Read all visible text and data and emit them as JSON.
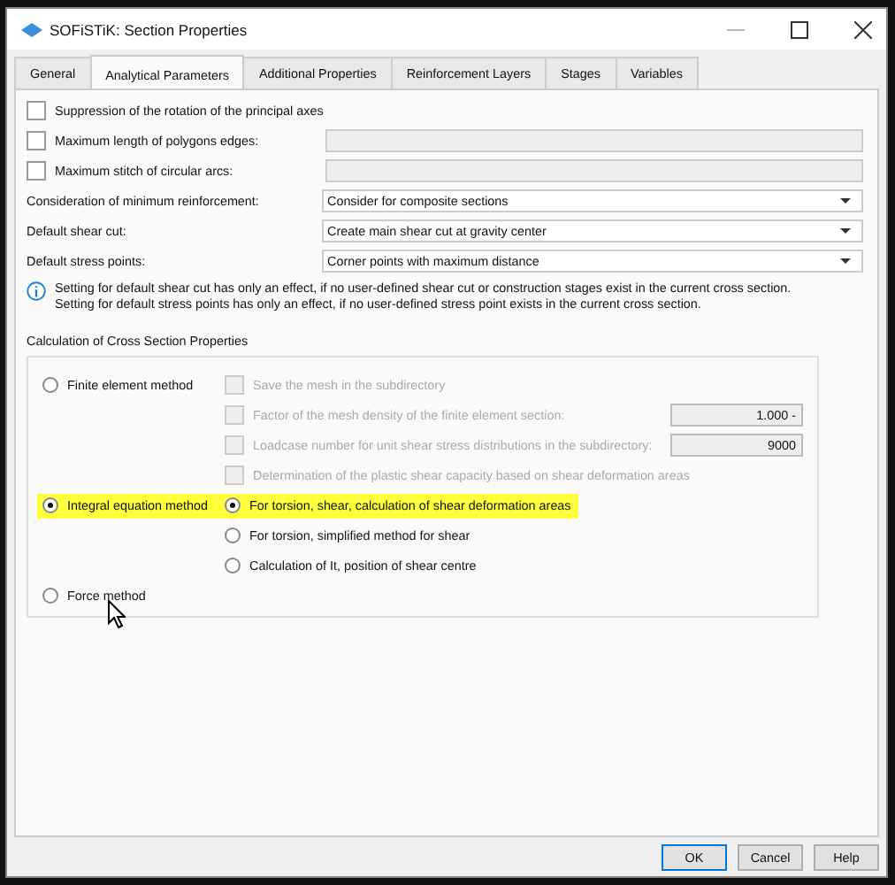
{
  "window": {
    "title": "SOFiSTiK: Section Properties"
  },
  "tabs": [
    {
      "label": "General",
      "selected": false
    },
    {
      "label": "Analytical Parameters",
      "selected": true
    },
    {
      "label": "Additional Properties",
      "selected": false
    },
    {
      "label": "Reinforcement Layers",
      "selected": false
    },
    {
      "label": "Stages",
      "selected": false
    },
    {
      "label": "Variables",
      "selected": false
    }
  ],
  "options": [
    {
      "kind": "checkbox",
      "label": "Suppression of the rotation of the principal axes",
      "checked": false
    },
    {
      "kind": "checkbox-field",
      "label": "Maximum length of polygons edges:",
      "checked": false,
      "disabled": true
    },
    {
      "kind": "checkbox-field",
      "label": "Maximum stitch of circular arcs:",
      "checked": false,
      "disabled": true
    }
  ],
  "dropdowns": [
    {
      "label": "Consideration of minimum reinforcement:",
      "value": "Consider for composite sections"
    },
    {
      "label": "Default shear cut:",
      "value": "Create main shear cut at gravity center"
    },
    {
      "label": "Default stress points:",
      "value": "Corner points with maximum distance"
    }
  ],
  "info": [
    "Setting for default shear cut has only an effect, if no user-defined shear cut or construction stages exist in the current cross section.",
    "Setting for default stress points has only an effect, if no user-defined stress point exists in the current cross section."
  ],
  "calculation": {
    "title": "Calculation of Cross Section Properties",
    "methods": [
      {
        "label": "Finite element method",
        "selected": false,
        "highlighted": false,
        "sub_options": [
          {
            "kind": "checkbox",
            "label": "Save the mesh in the subdirectory",
            "checked": false,
            "disabled": true
          },
          {
            "kind": "checkbox",
            "label": "Factor of the mesh density of the finite element section:",
            "checked": false,
            "disabled": true,
            "value": "1.000 -"
          },
          {
            "kind": "checkbox",
            "label": "Loadcase number for unit shear stress distributions in the subdirectory:",
            "checked": false,
            "disabled": true,
            "value": "9000"
          },
          {
            "kind": "checkbox",
            "label": "Determination of the plastic shear capacity based on shear deformation areas",
            "checked": false,
            "disabled": true
          }
        ]
      },
      {
        "label": "Integral equation method",
        "selected": true,
        "highlighted": true,
        "sub_options": [
          {
            "kind": "radio",
            "label": "For torsion, shear, calculation of shear deformation areas",
            "selected": true,
            "highlighted": true,
            "disabled": false
          },
          {
            "kind": "radio",
            "label": "For torsion, simplified method for shear",
            "selected": false,
            "highlighted": false,
            "disabled": false
          },
          {
            "kind": "radio",
            "label": "Calculation of  It, position of shear centre",
            "selected": false,
            "highlighted": false,
            "disabled": false
          }
        ]
      },
      {
        "label": "Force method",
        "selected": false,
        "highlighted": false
      }
    ]
  },
  "buttons": [
    "OK",
    "Cancel",
    "Help"
  ]
}
